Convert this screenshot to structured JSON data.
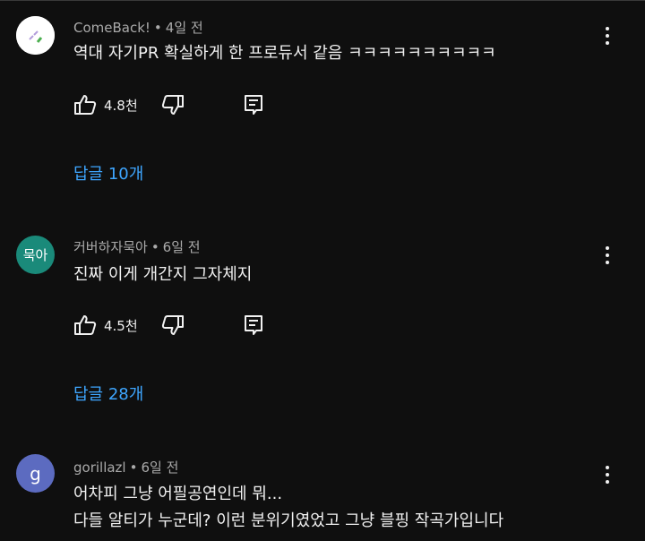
{
  "comments": [
    {
      "author": "ComeBack!",
      "time": "4일 전",
      "avatar_text": "",
      "avatar_color": "#ffffff",
      "text_lines": [
        "역대 자기PR 확실하게 한 프로듀서 같음 ㅋㅋㅋㅋㅋㅋㅋㅋㅋㅋ"
      ],
      "likes": "4.8천",
      "replies": "답글 10개"
    },
    {
      "author": "커버하자묵아",
      "time": "6일 전",
      "avatar_text": "묵아",
      "avatar_color": "#1a8a7a",
      "text_lines": [
        "진짜 이게 개간지 그자체지"
      ],
      "likes": "4.5천",
      "replies": "답글 28개"
    },
    {
      "author": "gorillazl",
      "time": "6일 전",
      "avatar_text": "g",
      "avatar_color": "#5c6bc0",
      "text_lines": [
        "어차피 그냥 어필공연인데 뭐...",
        "다들 알티가 누군데? 이런 분위기였었고 그냥 블핑 작곡가입니다"
      ]
    }
  ],
  "separator": "•",
  "icons": {
    "like": "thumb-up-icon",
    "dislike": "thumb-down-icon",
    "reply": "comment-reply-icon",
    "menu": "more-vert-icon"
  },
  "colors": {
    "background": "#0f0f0f",
    "text": "#f1f1f1",
    "meta": "#aaaaaa",
    "link": "#3ea6ff"
  }
}
